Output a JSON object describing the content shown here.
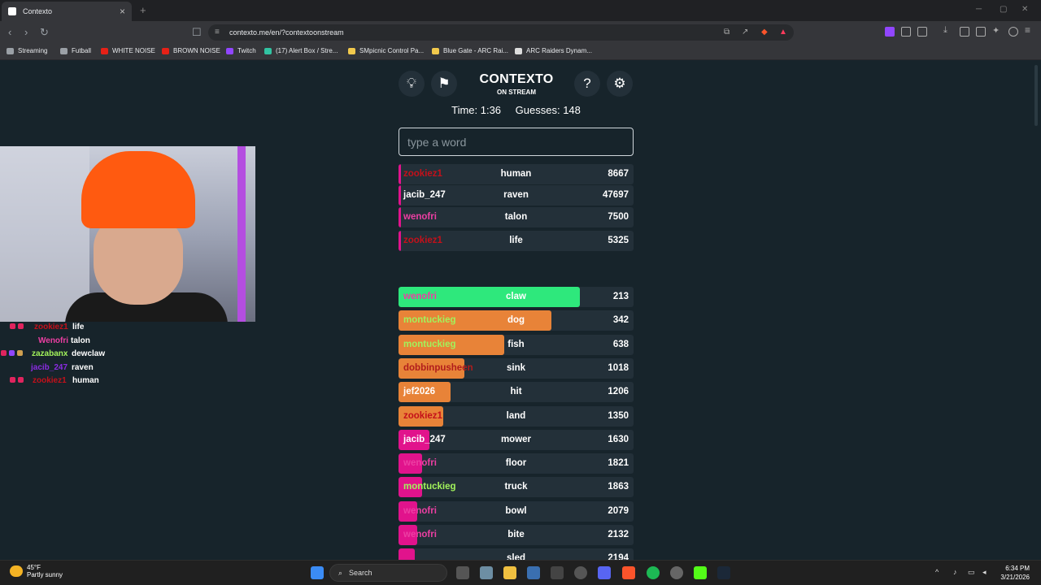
{
  "browser": {
    "tab_title": "Contexto",
    "url": "contexto.me/en/?contextoonstream",
    "bookmarks": [
      {
        "label": "Streaming",
        "color": "#9aa0a6"
      },
      {
        "label": "Futball",
        "color": "#9aa0a6"
      },
      {
        "label": "WHITE NOISE",
        "color": "#e62117"
      },
      {
        "label": "BROWN NOISE",
        "color": "#e62117"
      },
      {
        "label": "Twitch",
        "color": "#9146ff"
      },
      {
        "label": "(17) Alert Box / Stre...",
        "color": "#31c3a2"
      },
      {
        "label": "SMpicnic Control Pa...",
        "color": "#f2c94c"
      },
      {
        "label": "Blue Gate - ARC Rai...",
        "color": "#f2c94c"
      },
      {
        "label": "ARC Raiders Dynam...",
        "color": "#dddddd"
      }
    ]
  },
  "game": {
    "title": "CONTEXTO",
    "subtitle": "ON STREAM",
    "time_label": "Time: 1:36",
    "guesses_label": "Guesses: 148",
    "input_placeholder": "type a word",
    "recent": [
      {
        "user": "zookiez1",
        "word": "human",
        "distance": "8667",
        "user_color": "#c4101a"
      },
      {
        "user": "jacib_247",
        "word": "raven",
        "distance": "47697",
        "user_color": "#ffffff"
      },
      {
        "user": "wenofri",
        "word": "talon",
        "distance": "7500",
        "user_color": "#ec3fa3"
      },
      {
        "user": "zookiez1",
        "word": "life",
        "distance": "5325",
        "user_color": "#c4101a"
      }
    ],
    "ranked": [
      {
        "user": "wenofri",
        "word": "claw",
        "distance": "213",
        "bar_fraction": 0.77,
        "bar_color": "#2ee87c",
        "user_color": "#ec3fa3"
      },
      {
        "user": "montuckieg",
        "word": "dog",
        "distance": "342",
        "bar_fraction": 0.65,
        "bar_color": "#e88338",
        "user_color": "#a2f25b"
      },
      {
        "user": "montuckieg",
        "word": "fish",
        "distance": "638",
        "bar_fraction": 0.45,
        "bar_color": "#e88338",
        "user_color": "#a2f25b"
      },
      {
        "user": "dobbinpusheen",
        "word": "sink",
        "distance": "1018",
        "bar_fraction": 0.28,
        "bar_color": "#e88338",
        "user_color": "#b01c1c"
      },
      {
        "user": "jef2026",
        "word": "hit",
        "distance": "1206",
        "bar_fraction": 0.22,
        "bar_color": "#e88338",
        "user_color": "#ffffff"
      },
      {
        "user": "zookiez1",
        "word": "land",
        "distance": "1350",
        "bar_fraction": 0.19,
        "bar_color": "#e88338",
        "user_color": "#c4101a"
      },
      {
        "user": "jacib_247",
        "word": "mower",
        "distance": "1630",
        "bar_fraction": 0.13,
        "bar_color": "#e1138c",
        "user_color": "#ffffff"
      },
      {
        "user": "wenofri",
        "word": "floor",
        "distance": "1821",
        "bar_fraction": 0.1,
        "bar_color": "#e1138c",
        "user_color": "#ec3fa3"
      },
      {
        "user": "montuckieg",
        "word": "truck",
        "distance": "1863",
        "bar_fraction": 0.1,
        "bar_color": "#e1138c",
        "user_color": "#a2f25b"
      },
      {
        "user": "wenofri",
        "word": "bowl",
        "distance": "2079",
        "bar_fraction": 0.08,
        "bar_color": "#e1138c",
        "user_color": "#ec3fa3"
      },
      {
        "user": "wenofri",
        "word": "bite",
        "distance": "2132",
        "bar_fraction": 0.08,
        "bar_color": "#e1138c",
        "user_color": "#ec3fa3"
      },
      {
        "user": "",
        "word": "sled",
        "distance": "2194",
        "bar_fraction": 0.07,
        "bar_color": "#e1138c",
        "user_color": "#ec3fa3"
      }
    ]
  },
  "chat": [
    {
      "user": "zookiez1",
      "message": "life",
      "user_color": "#c4101a",
      "badges": [
        "#e0245e",
        "#e0245e"
      ]
    },
    {
      "user": "Wenofri",
      "message": "talon",
      "user_color": "#ec3fa3",
      "badges": []
    },
    {
      "user": "zazabanx",
      "message": "dewclaw",
      "user_color": "#a2f25b",
      "badges": [
        "#e0245e",
        "#9146ff",
        "#d0a050"
      ]
    },
    {
      "user": "jacib_247",
      "message": "raven",
      "user_color": "#8a2be2",
      "badges": []
    },
    {
      "user": "zookiez1",
      "message": "human",
      "user_color": "#c4101a",
      "badges": [
        "#e0245e",
        "#e0245e"
      ]
    }
  ],
  "taskbar": {
    "weather_temp": "45°F",
    "weather_desc": "Partly sunny",
    "search_label": "Search",
    "time": "6:34 PM",
    "date": "3/21/2026"
  }
}
